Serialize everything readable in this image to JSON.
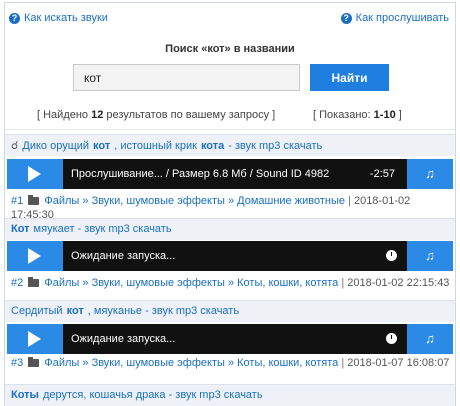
{
  "help": {
    "left_label": "Как искать звуки",
    "right_label": "Как прослушивать"
  },
  "search": {
    "title": "Поиск «кот» в названии",
    "value": "кот",
    "button_label": "Найти"
  },
  "stats": {
    "found_prefix": "[ Найдено",
    "found_count": "12",
    "found_suffix": "результатов по вашему запросу ]",
    "shown_prefix": "[ Показано:",
    "shown_range": "1-10",
    "shown_suffix": "]"
  },
  "results": [
    {
      "title_parts": [
        "Дико орущий ",
        "кот",
        ", истошный крик ",
        "кота",
        " - звук mp3 скачать"
      ],
      "player_status": "Прослушивание... / Размер 6.8 Мб / Sound ID 4982",
      "player_time": "-2:57",
      "number": "#1",
      "breadcrumb": [
        "Файлы",
        "Звуки, шумовые эффекты",
        "Домашние животные"
      ],
      "date": "2018-01-02",
      "time": "17:45:30"
    },
    {
      "title_parts": [
        "Кот",
        " мяукает - звук mp3 скачать"
      ],
      "player_status": "Ожидание запуска...",
      "number": "#2",
      "breadcrumb": [
        "Файлы",
        "Звуки, шумовые эффекты",
        "Коты, кошки, котята"
      ],
      "date": "2018-01-02",
      "time": "22:15:43"
    },
    {
      "title_parts": [
        "Сердитый ",
        "кот",
        ", мяуканье - звук mp3 скачать"
      ],
      "player_status": "Ожидание запуска...",
      "number": "#3",
      "breadcrumb": [
        "Файлы",
        "Звуки, шумовые эффекты",
        "Коты, кошки, котята"
      ],
      "date": "2018-01-07",
      "time": "16:08:07"
    },
    {
      "title_parts": [
        "Коты",
        " дерутся, кошачья драка - звук mp3 скачать"
      ]
    }
  ],
  "colors": {
    "accent": "#1e7fe0",
    "link": "#1a6fc2",
    "player_bg": "#111111",
    "row_header_bg": "#eef2f6"
  },
  "icons": {
    "help": "question-circle-icon",
    "headphones": "headphones-icon",
    "play": "play-icon",
    "note": "music-note-icon",
    "clock": "clock-icon",
    "folder": "folder-icon"
  }
}
